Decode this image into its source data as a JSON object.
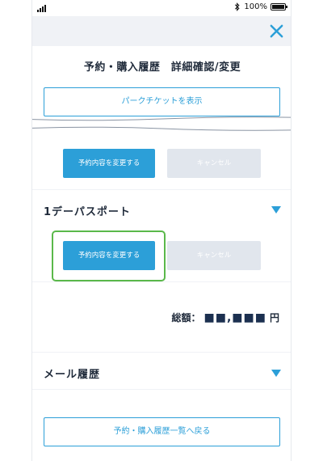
{
  "status_bar": {
    "battery_text": "100%"
  },
  "header": {
    "close_icon": "close-icon"
  },
  "page": {
    "title": "予約・購入履歴　詳細確認/変更"
  },
  "park_ticket_button": {
    "label": "パークチケットを表示"
  },
  "reservation_section": {
    "change_label": "予約内容を変更する",
    "cancel_label": "キャンセル"
  },
  "day_passport": {
    "title": "1デーパスポート",
    "change_label": "予約内容を変更する",
    "cancel_label": "キャンセル"
  },
  "total": {
    "label": "総額：",
    "amount": "■■,■■■",
    "unit": "円"
  },
  "mail_history": {
    "title": "メール履歴"
  },
  "back_button": {
    "label": "予約・購入履歴一覧へ戻る"
  },
  "colors": {
    "accent": "#2c9fd8",
    "highlight": "#5ab84a",
    "disabled": "#e1e6ed",
    "background": "#f0f2f6"
  }
}
